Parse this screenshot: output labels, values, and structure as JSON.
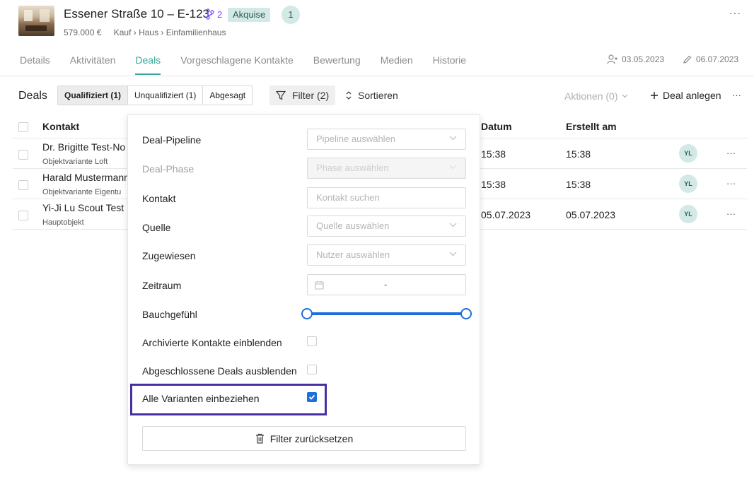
{
  "header": {
    "title": "Essener Straße 10 – E-123",
    "variants_count": "2",
    "status_badge": "Akquise",
    "count_badge": "1",
    "price": "579.000 €",
    "breadcrumb": "Kauf › Haus › Einfamilienhaus",
    "more": "···",
    "icons": {
      "variant": "git-branch-icon"
    }
  },
  "tabs": [
    {
      "label": "Details"
    },
    {
      "label": "Aktivitäten"
    },
    {
      "label": "Deals",
      "active": true
    },
    {
      "label": "Vorgeschlagene Kontakte"
    },
    {
      "label": "Bewertung"
    },
    {
      "label": "Medien"
    },
    {
      "label": "Historie"
    }
  ],
  "meta": {
    "created": "03.05.2023",
    "edited": "06.07.2023",
    "icons": {
      "created": "user-plus-icon",
      "edited": "pencil-icon"
    }
  },
  "toolbar": {
    "title": "Deals",
    "segments": [
      "Qualifiziert (1)",
      "Unqualifiziert (1)",
      "Abgesagt"
    ],
    "filter": "Filter (2)",
    "sort": "Sortieren",
    "actions": "Aktionen (0)",
    "add_deal": "Deal anlegen",
    "more": "···"
  },
  "table": {
    "columns": {
      "contact": "Kontakt",
      "date": "Datum",
      "created": "Erstellt am"
    },
    "rows": [
      {
        "name": "Dr. Brigitte Test-No",
        "sub": "Objektvariante Loft",
        "date": "15:38",
        "created": "15:38",
        "avatar": "YL",
        "more": "···"
      },
      {
        "name": "Harald Mustermann",
        "sub": "Objektvariante Eigentu",
        "date": "15:38",
        "created": "15:38",
        "avatar": "YL",
        "more": "···"
      },
      {
        "name": "Yi-Ji Lu Scout Test",
        "sub": "Hauptobjekt",
        "date": "05.07.2023",
        "created": "05.07.2023",
        "avatar": "YL",
        "more": "···"
      }
    ]
  },
  "filter_panel": {
    "pipeline": {
      "label": "Deal-Pipeline",
      "placeholder": "Pipeline auswählen"
    },
    "phase": {
      "label": "Deal-Phase",
      "placeholder": "Phase auswählen"
    },
    "contact": {
      "label": "Kontakt",
      "placeholder": "Kontakt suchen"
    },
    "source": {
      "label": "Quelle",
      "placeholder": "Quelle auswählen"
    },
    "assigned": {
      "label": "Zugewiesen",
      "placeholder": "Nutzer auswählen"
    },
    "period": {
      "label": "Zeitraum",
      "separator": "-"
    },
    "gut_feeling": {
      "label": "Bauchgefühl",
      "range": [
        0,
        1
      ]
    },
    "archived": {
      "label": "Archivierte Kontakte einblenden",
      "checked": false
    },
    "closed": {
      "label": "Abgeschlossene Deals ausblenden",
      "checked": false
    },
    "all_variants": {
      "label": "Alle Varianten einbeziehen",
      "checked": true
    },
    "reset": "Filter zurücksetzen"
  },
  "colors": {
    "accent": "#3aa59a",
    "primary_blue": "#1e6fd9",
    "highlight": "#4a2ea3",
    "badge_bg": "#d3e9e5"
  }
}
